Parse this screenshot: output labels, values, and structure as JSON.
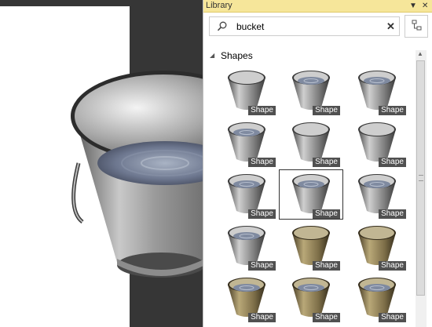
{
  "panel": {
    "title": "Library",
    "dropdown_icon": "▼",
    "close_icon": "✕"
  },
  "search": {
    "value": "bucket",
    "placeholder": "",
    "clear_icon": "✕"
  },
  "section": {
    "label": "Shapes",
    "arrow": "◢"
  },
  "shape_tag": "Shape",
  "shapes": [
    {
      "material": "steel",
      "water": false
    },
    {
      "material": "steel",
      "water": true
    },
    {
      "material": "steel",
      "water": true
    },
    {
      "material": "steel",
      "water": true
    },
    {
      "material": "steel",
      "water": false
    },
    {
      "material": "steel",
      "water": false
    },
    {
      "material": "steel",
      "water": true
    },
    {
      "material": "steel",
      "water": true
    },
    {
      "material": "steel",
      "water": true
    },
    {
      "material": "steel",
      "water": true
    },
    {
      "material": "brass",
      "water": false
    },
    {
      "material": "brass",
      "water": false
    },
    {
      "material": "brass",
      "water": true
    },
    {
      "material": "brass",
      "water": true
    },
    {
      "material": "brass",
      "water": true
    }
  ],
  "selected_index": 7,
  "colors": {
    "title_bar": "#f6e69a",
    "tag_bg": "#505050",
    "steel": "#8a8a8a",
    "brass": "#8a7a52"
  }
}
